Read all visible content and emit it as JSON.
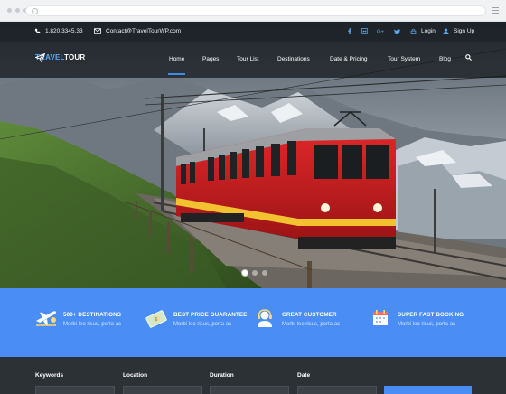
{
  "topbar": {
    "phone": "1.820.3345.33",
    "email": "Contact@TravelTourWP.com",
    "login": "Login",
    "signup": "Sign Up"
  },
  "logo": {
    "part1": "TRAVEL",
    "part2": "TOUR"
  },
  "nav": {
    "items": [
      "Home",
      "Pages",
      "Tour List",
      "Destinations",
      "Date & Pricing",
      "Tour System",
      "Blog"
    ],
    "active": "Home"
  },
  "slider": {
    "slides": 3,
    "current": 1
  },
  "features": [
    {
      "title": "500+ DESTINATIONS",
      "desc": "Morbi leo risus, porta ac",
      "icon": "plane-icon"
    },
    {
      "title": "BEST PRICE GUARANTEE",
      "desc": "Morbi leo risus, porta ac",
      "icon": "money-icon"
    },
    {
      "title": "GREAT CUSTOMER",
      "desc": "Morbi leo risus, porta ac",
      "icon": "support-icon"
    },
    {
      "title": "SUPER FAST BOOKING",
      "desc": "Morbi leo risus, porta ac",
      "icon": "calendar-icon"
    }
  ],
  "search": {
    "fields": [
      "Keywords",
      "Location",
      "Duration",
      "Date"
    ]
  },
  "colors": {
    "accent": "#4a8ef5",
    "nav_bg": "#16191d",
    "search_bg": "#2c3136"
  }
}
